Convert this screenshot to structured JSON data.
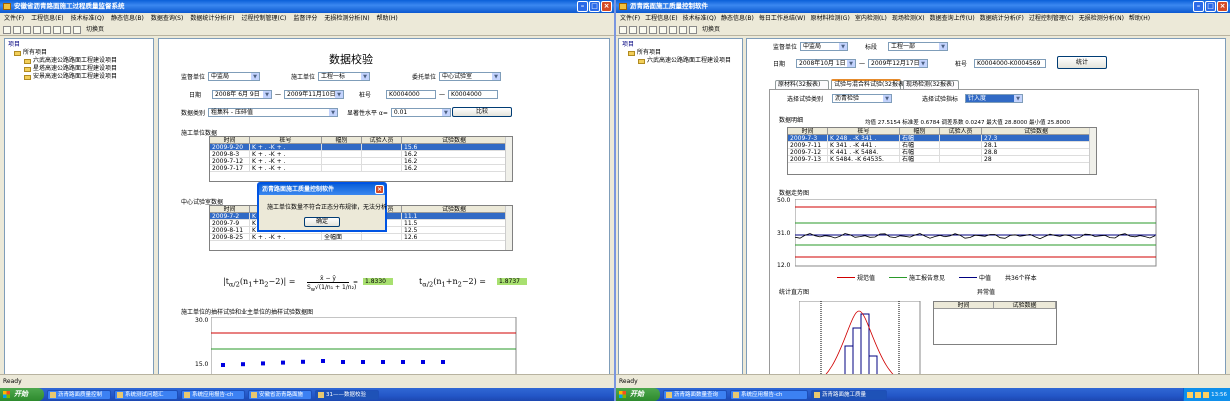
{
  "left": {
    "title": "安徽省沥青路面施工过程质量监督系统",
    "menu": [
      "文件(F)",
      "工程信息(E)",
      "技术标准(Q)",
      "静态信息(B)",
      "数据查询(S)",
      "数据统计分析(F)",
      "过程控制管理(C)",
      "监督评分",
      "无损检测分析(N)",
      "帮助(H)"
    ],
    "toolbar_text": "切换页",
    "tree": {
      "root": "项目",
      "group": "所有项目",
      "items": [
        "六武高速公路路面工程建设项目",
        "星塔高速公路路面工程建设项目",
        "安景高速公路路面工程建设项目"
      ]
    },
    "form": {
      "heading": "数据校验",
      "labels": {
        "org": "监督单位",
        "construction": "施工单位",
        "entrust": "委托单位",
        "date": "日期",
        "dash": "一",
        "pile": "桩号",
        "category": "数据类别",
        "significance": "显著性水平 α=",
        "compare": "比较"
      },
      "org_value": "中监局",
      "construction_value": "工程一标",
      "entrust_value": "中心试验室",
      "date_from": "2008年 6月 9日",
      "date_to": "2009年11月10日",
      "pile_from": "K0004000",
      "pile_to": "K0004000",
      "category_value": "粗集料 - 压碎值",
      "alpha": "0.01"
    },
    "table1": {
      "title": "施工单位数据",
      "headers": [
        "时间",
        "桩号",
        "幅别",
        "试验人员",
        "试验数据"
      ],
      "rows": [
        [
          "2009-9-20",
          "K + . -K + .",
          "",
          "",
          "15.6"
        ],
        [
          "2009-8-3",
          "K + . -K + .",
          "",
          "",
          "16.2"
        ],
        [
          "2009-7-12",
          "K + . -K + .",
          "",
          "",
          "16.2"
        ],
        [
          "2009-7-17",
          "K + . -K + .",
          "",
          "",
          "16.2"
        ]
      ]
    },
    "table2": {
      "title": "中心试验室数据",
      "headers": [
        "时间",
        "桩号",
        "幅别",
        "试验人员",
        "试验数据"
      ],
      "rows": [
        [
          "2009-7-2",
          "K + . -K + .",
          "",
          "",
          "11.1"
        ],
        [
          "2009-7-9",
          "K + . -K + .",
          "",
          "",
          "11.5"
        ],
        [
          "2009-8-11",
          "K + . -K + .",
          "",
          "",
          "12.5"
        ],
        [
          "2009-8-25",
          "K + . -K + .",
          "全幅面",
          "",
          "12.6"
        ]
      ]
    },
    "formula": {
      "t_value": "1.8330",
      "t_crit": "1.8737",
      "numerator": "x̄ − ȳ"
    },
    "chart": {
      "title": "施工单位的抽样试验和业主单位的抽样试验数据图",
      "y_top": "30.0",
      "y_mid": "15.0"
    },
    "dialog": {
      "title": "沥青路面施工质量控制软件",
      "message": "施工单位数量不符合正态分布规律，无法分析",
      "ok": "确定"
    },
    "status": "Ready",
    "taskbar": {
      "start": "开始",
      "tasks": [
        "沥青路面质量控制",
        "系统测试问题汇",
        "系统应用报告-ch",
        "安徽省沥青路面施",
        "31——数据校验"
      ],
      "clock": ""
    }
  },
  "right": {
    "title": "沥青路面施工质量控制软件",
    "menu": [
      "文件(F)",
      "工程信息(E)",
      "技术标准(Q)",
      "静态信息(B)",
      "每日工作总结(W)",
      "原材料检测(G)",
      "室内检测(L)",
      "现场检测(X)",
      "数据查询上传(U)",
      "数据统计分析(F)",
      "过程控制管理(C)",
      "无损检测分析(N)",
      "帮助(H)"
    ],
    "toolbar_text": "切换页",
    "tree": {
      "root": "项目",
      "group": "所有项目",
      "items": [
        "六武高速公路路面工程建设项目"
      ]
    },
    "form": {
      "labels": {
        "org": "监督单位",
        "section": "标段",
        "date": "日期",
        "dash": "一",
        "pile": "桩号",
        "stat": "统计"
      },
      "org_value": "中监局",
      "section_value": "工程一部",
      "date_from": "2008年10月 1日",
      "date_to": "2009年12月17日",
      "pile_value": "K0004000-K0004569"
    },
    "tabs": [
      "原材料(32报表)",
      "试验与混合料试验(32报表)",
      "现场检测(32报表)"
    ],
    "select_item_label": "选择试验类别",
    "select_item_value": "沥青检验",
    "select_index_label": "选择试验指标",
    "select_index_value": "针入度",
    "table": {
      "title": "数据明细",
      "summary": "均值 27.5154  标准差 0.6784  调差系数 0.0247  最大值 28.8000  最小值 25.8000",
      "headers": [
        "时间",
        "桩号",
        "幅别",
        "试验人员",
        "试验数据"
      ],
      "rows": [
        [
          "2009-7-3",
          "K 248 . -K 341 .",
          "右幅",
          "",
          "27.3"
        ],
        [
          "2009-7-11",
          "K 341 . -K 441 .",
          "右幅",
          "",
          "28.1"
        ],
        [
          "2009-7-12",
          "K 441 . -K 5484.",
          "右幅",
          "",
          "28.8"
        ],
        [
          "2009-7-13",
          "K 5484. -K 64535.",
          "右幅",
          "",
          "28"
        ]
      ]
    },
    "trend": {
      "title": "数据走势图",
      "y_top": "50.0",
      "y_mid": "31.0",
      "y_bot": "12.0",
      "legend": [
        "规范值",
        "施工报告意见",
        "中值"
      ],
      "samples": "共36个样本"
    },
    "hist_title": "统计直方图",
    "abnormal": {
      "title": "异常值",
      "headers": [
        "时间",
        "试验数据"
      ]
    },
    "status": "Ready",
    "taskbar": {
      "start": "开始",
      "tasks": [
        "沥青路面数量查询",
        "系统应用报告-ch",
        "沥青路面施工质量"
      ],
      "clock": "13:56"
    }
  },
  "colors": {
    "title_blue": "#0a5fd8",
    "select_blue": "#316ac5",
    "red": "#d00000",
    "green": "#2a9a2a",
    "navy": "#000080",
    "marker_blue": "#0000e0",
    "marker_pink": "#ff69b4"
  }
}
